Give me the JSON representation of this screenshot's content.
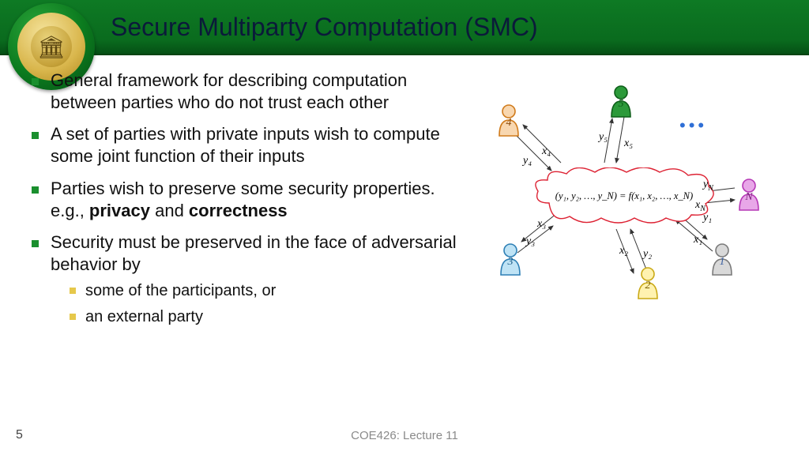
{
  "header": {
    "title": "Secure Multiparty Computation (SMC)"
  },
  "bullets": {
    "b1": "General framework for describing computation between parties who do not trust each other",
    "b2": "A set of parties with private inputs wish to compute some joint function of their inputs",
    "b3_pre": "Parties wish to preserve some security properties. e.g., ",
    "b3_bold1": "privacy",
    "b3_mid": " and ",
    "b3_bold2": "correctness",
    "b4": "Security must be preserved in the face of adversarial behavior by",
    "s1": "some of the participants, or",
    "s2": "an external party"
  },
  "diagram": {
    "formula": "(y₁, y₂, …, y_N) = f(x₁, x₂, …, x_N)",
    "pawns": {
      "p1": {
        "label": "1",
        "color": "#d9d9d9",
        "stroke": "#7a7a7a",
        "text": "#3a5fa0"
      },
      "p2": {
        "label": "2",
        "color": "#fff2b0",
        "stroke": "#caa915",
        "text": "#7a5f00"
      },
      "p3": {
        "label": "3",
        "color": "#bfe3f5",
        "stroke": "#2d7fb5",
        "text": "#195b86"
      },
      "p4": {
        "label": "4",
        "color": "#f8d7b0",
        "stroke": "#d07a1a",
        "text": "#8a4a0a"
      },
      "p5": {
        "label": "5",
        "color": "#2c9a3a",
        "stroke": "#0d5e18",
        "text": "#0d5e18"
      },
      "pN": {
        "label": "N",
        "color": "#e8a7e8",
        "stroke": "#b638b6",
        "text": "#7a1f7a"
      }
    },
    "labels": {
      "x1": "x₁",
      "y1": "y₁",
      "x2": "x₂",
      "y2": "y₂",
      "x3": "x₃",
      "y3": "y₃",
      "x4": "x₄",
      "y4": "y₄",
      "x5": "x₅",
      "y5": "y₅",
      "xN": "x_N",
      "yN": "y_N"
    }
  },
  "footer": {
    "page": "5",
    "course": "COE426: Lecture 11"
  }
}
